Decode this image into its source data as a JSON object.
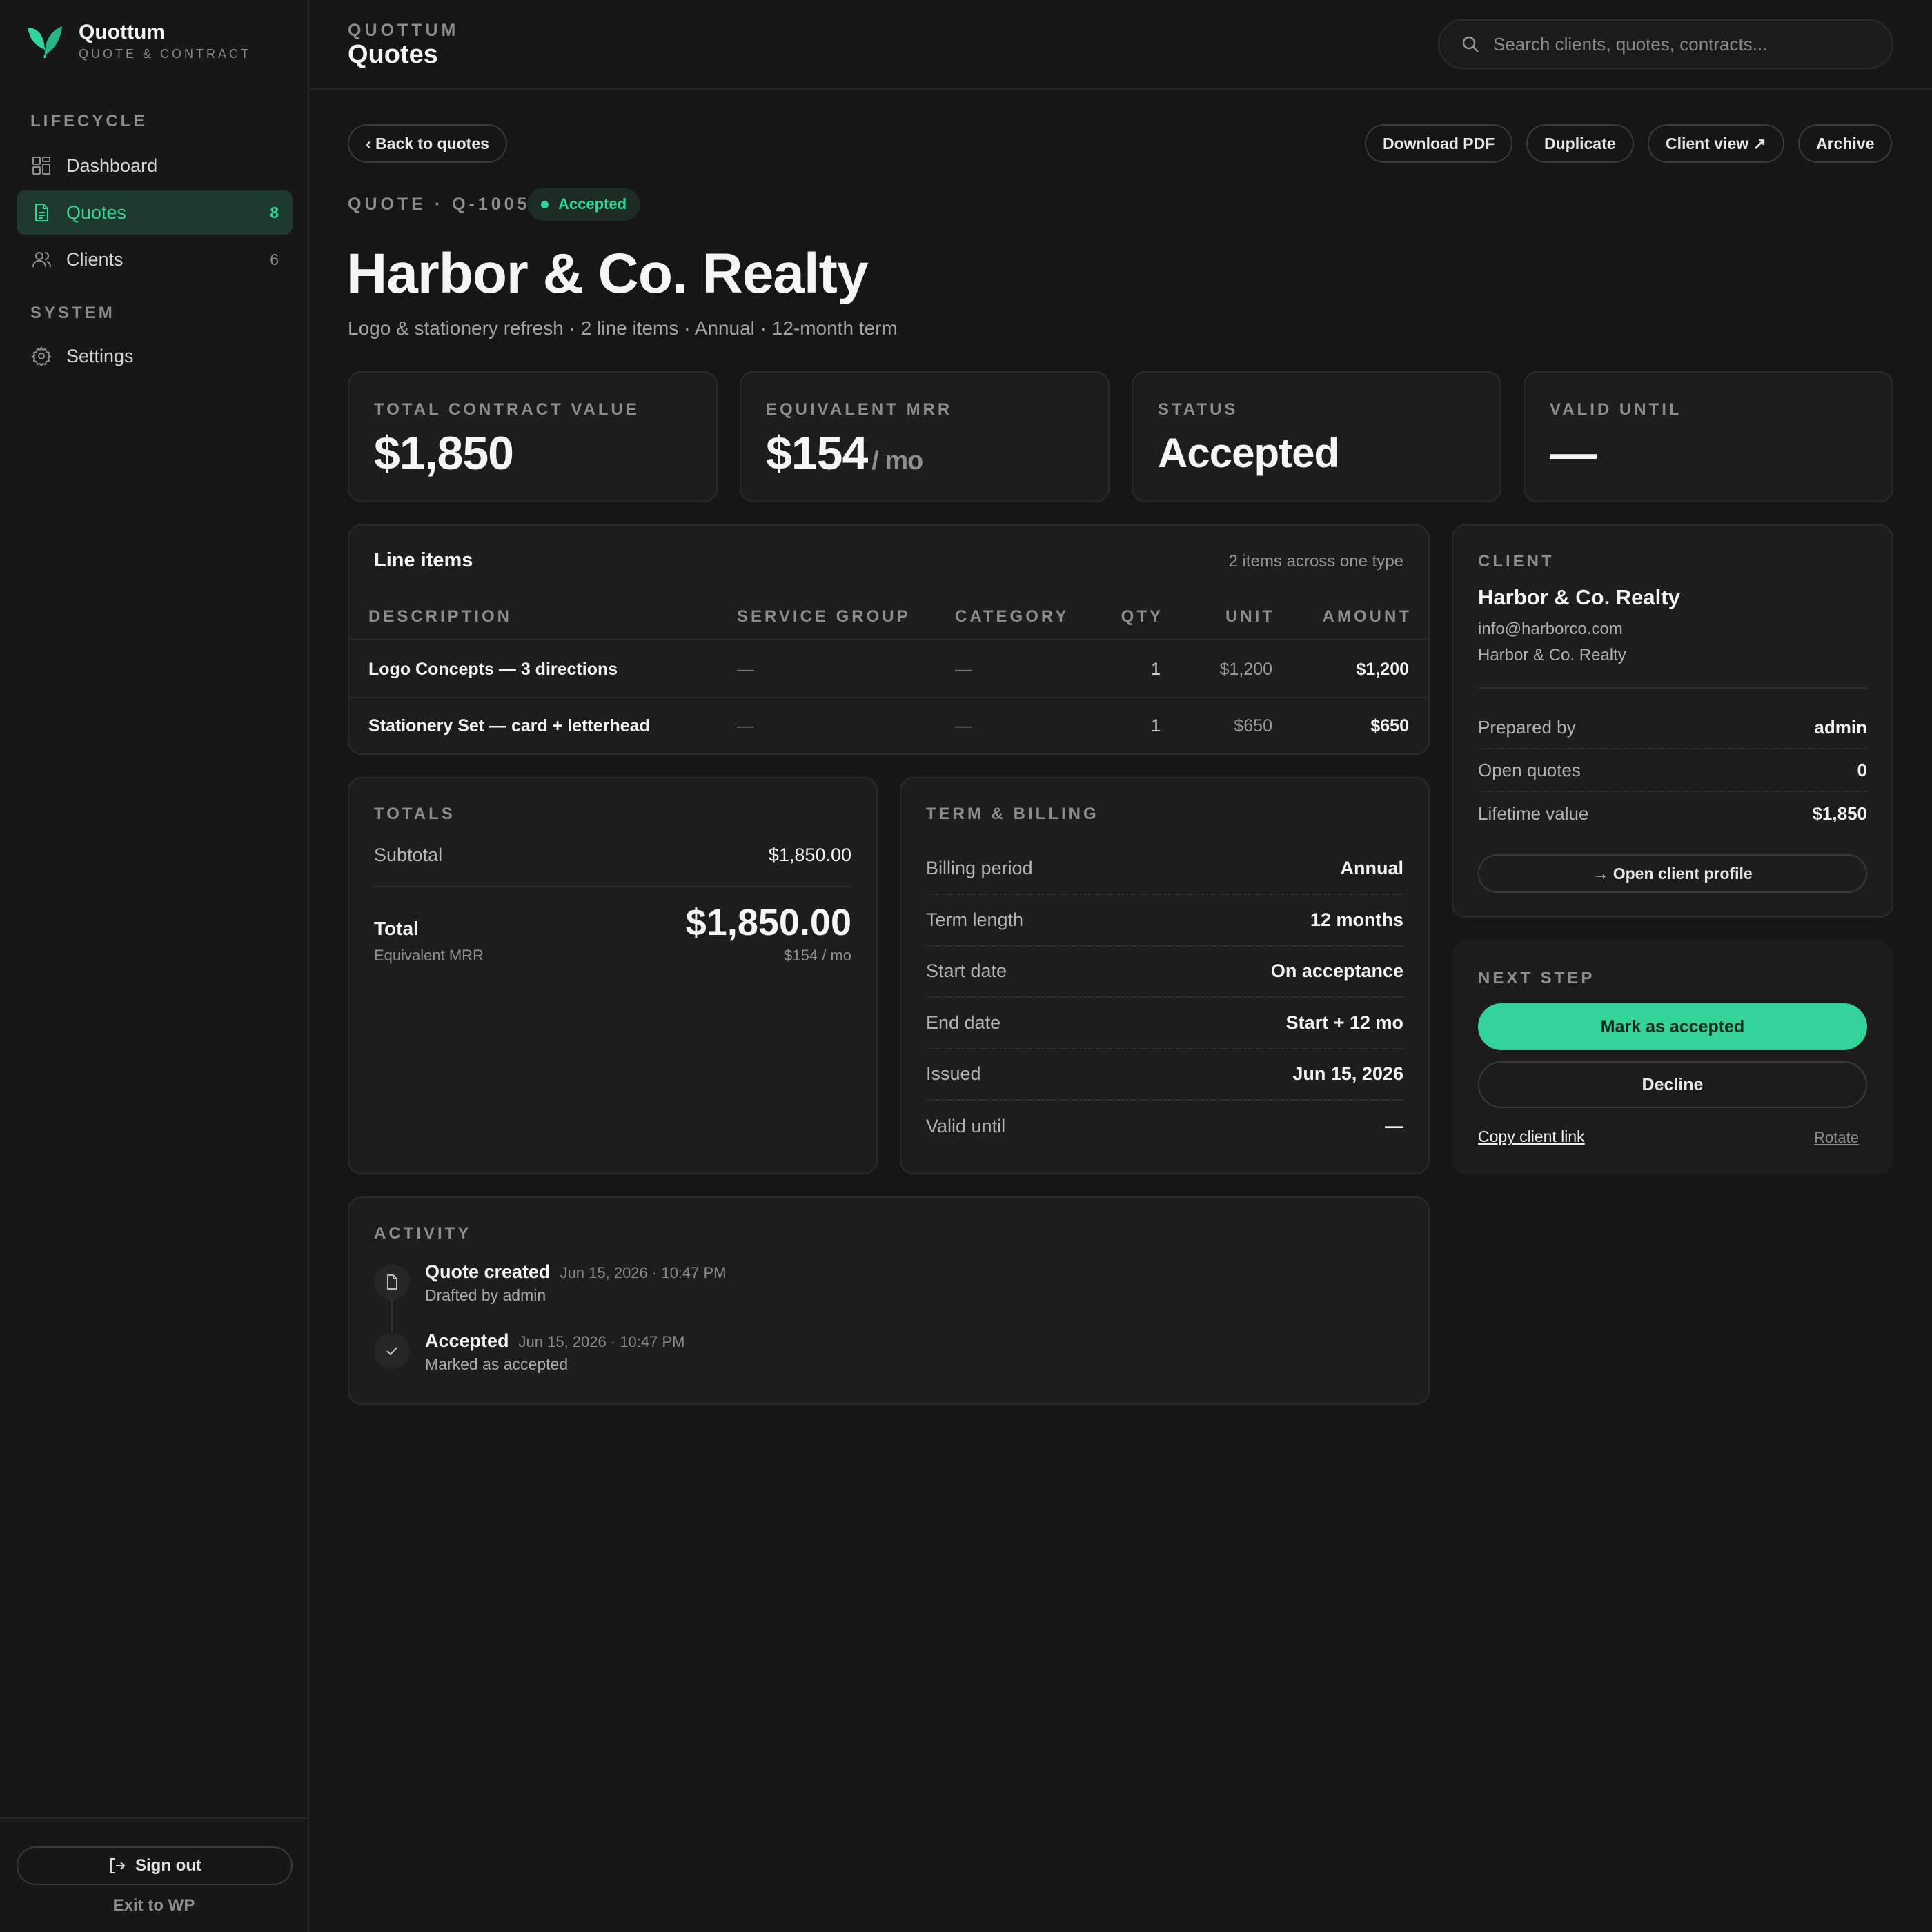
{
  "brand": {
    "name": "Quottum",
    "subtitle": "QUOTE & CONTRACT",
    "accent": "#34d399"
  },
  "sidebar": {
    "sections": [
      {
        "label": "LIFECYCLE"
      },
      {
        "label": "SYSTEM"
      }
    ],
    "items": [
      {
        "label": "Dashboard",
        "icon": "dashboard-icon",
        "count": ""
      },
      {
        "label": "Quotes",
        "icon": "document-icon",
        "count": "8",
        "active": true
      },
      {
        "label": "Clients",
        "icon": "users-icon",
        "count": "6"
      },
      {
        "label": "Settings",
        "icon": "gear-icon",
        "count": ""
      }
    ],
    "sign_out": "Sign out",
    "exit": "Exit to WP"
  },
  "header": {
    "eyebrow": "QUOTTUM",
    "title": "Quotes",
    "search_placeholder": "Search clients, quotes, contracts..."
  },
  "toolbar": {
    "back": "‹ Back to quotes",
    "download": "Download PDF",
    "duplicate": "Duplicate",
    "client_view": "Client view ↗",
    "archive": "Archive"
  },
  "quote": {
    "id_label": "QUOTE · Q-1005",
    "status": "Accepted",
    "title": "Harbor & Co. Realty",
    "subtitle": "Logo & stationery refresh · 2 line items · Annual · 12-month term"
  },
  "stats": [
    {
      "label": "TOTAL CONTRACT VALUE",
      "value": "$1,850",
      "unit": ""
    },
    {
      "label": "EQUIVALENT MRR",
      "value": "$154",
      "unit": "/ mo"
    },
    {
      "label": "STATUS",
      "value": "Accepted",
      "unit": ""
    },
    {
      "label": "VALID UNTIL",
      "value": "—",
      "unit": ""
    }
  ],
  "line_items": {
    "title": "Line items",
    "meta": "2 items across one type",
    "columns": [
      "DESCRIPTION",
      "SERVICE GROUP",
      "CATEGORY",
      "QTY",
      "UNIT",
      "AMOUNT"
    ],
    "rows": [
      {
        "description": "Logo Concepts — 3 directions",
        "group": "—",
        "category": "—",
        "qty": "1",
        "unit": "$1,200",
        "amount": "$1,200"
      },
      {
        "description": "Stationery Set — card + letterhead",
        "group": "—",
        "category": "—",
        "qty": "1",
        "unit": "$650",
        "amount": "$650"
      }
    ]
  },
  "totals": {
    "label": "TOTALS",
    "subtotal_label": "Subtotal",
    "subtotal": "$1,850.00",
    "total_label": "Total",
    "total": "$1,850.00",
    "mrr_label": "Equivalent MRR",
    "mrr": "$154 / mo"
  },
  "term": {
    "label": "TERM & BILLING",
    "rows": [
      {
        "k": "Billing period",
        "v": "Annual"
      },
      {
        "k": "Term length",
        "v": "12 months"
      },
      {
        "k": "Start date",
        "v": "On acceptance"
      },
      {
        "k": "End date",
        "v": "Start + 12 mo"
      },
      {
        "k": "Issued",
        "v": "Jun 15, 2026"
      },
      {
        "k": "Valid until",
        "v": "—"
      }
    ]
  },
  "activity": {
    "label": "ACTIVITY",
    "items": [
      {
        "title": "Quote created",
        "time": "Jun 15, 2026 · 10:47 PM",
        "desc": "Drafted by admin",
        "icon": "document-icon"
      },
      {
        "title": "Accepted",
        "time": "Jun 15, 2026 · 10:47 PM",
        "desc": "Marked as accepted",
        "icon": "check-icon"
      }
    ]
  },
  "client": {
    "label": "CLIENT",
    "name": "Harbor & Co. Realty",
    "email": "info@harborco.com",
    "company": "Harbor & Co. Realty",
    "rows": [
      {
        "k": "Prepared by",
        "v": "admin"
      },
      {
        "k": "Open quotes",
        "v": "0"
      },
      {
        "k": "Lifetime value",
        "v": "$1,850"
      }
    ],
    "open_profile": "→ Open client profile"
  },
  "next_step": {
    "label": "NEXT STEP",
    "accept": "Mark as accepted",
    "decline": "Decline",
    "copy_link": "Copy client link",
    "rotate": "Rotate"
  }
}
